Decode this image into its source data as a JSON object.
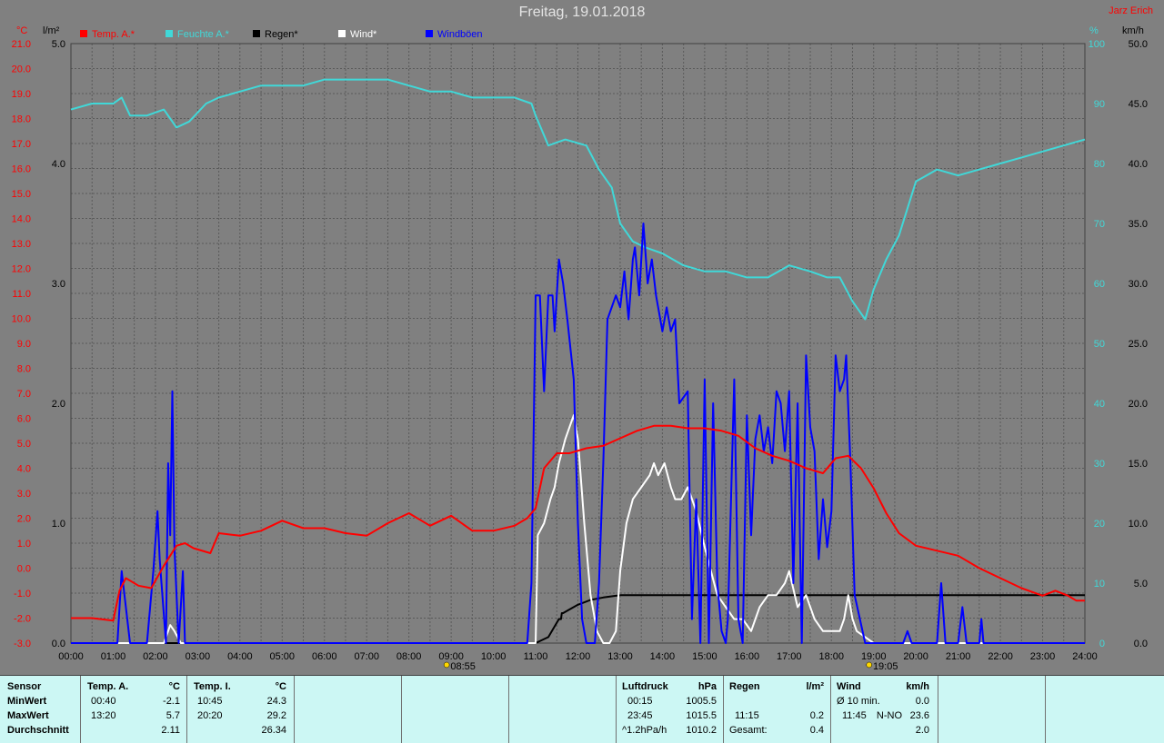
{
  "title": "Freitag, 19.01.2018",
  "author": "Jarz Erich",
  "colors": {
    "background": "#808080",
    "grid": "#5a5a5a",
    "temp": "#ff0000",
    "humidity": "#40d8d8",
    "rain": "#000000",
    "wind": "#ffffff",
    "gusts": "#0000ff",
    "stats_bg": "#ccf7f4"
  },
  "chart_data": {
    "type": "line",
    "title": "Freitag, 19.01.2018",
    "x_ticks": [
      "00:00",
      "01:00",
      "02:00",
      "03:00",
      "04:00",
      "05:00",
      "06:00",
      "07:00",
      "08:00",
      "09:00",
      "10:00",
      "11:00",
      "12:00",
      "13:00",
      "14:00",
      "15:00",
      "16:00",
      "17:00",
      "18:00",
      "19:00",
      "20:00",
      "21:00",
      "22:00",
      "23:00",
      "24:00"
    ],
    "x_range_hours": [
      0,
      24
    ],
    "sun_markers": [
      {
        "label": "08:55",
        "hour": 9.0
      },
      {
        "label": "19:05",
        "hour": 19.0
      }
    ],
    "axes": {
      "temp": {
        "unit": "°C",
        "range": [
          -3,
          21
        ],
        "ticks": [
          "21.0",
          "20.0",
          "19.0",
          "18.0",
          "17.0",
          "16.0",
          "15.0",
          "14.0",
          "13.0",
          "12.0",
          "11.0",
          "10.0",
          "9.0",
          "8.0",
          "7.0",
          "6.0",
          "5.0",
          "4.0",
          "3.0",
          "2.0",
          "1.0",
          "0.0",
          "-1.0",
          "-2.0",
          "-3.0"
        ]
      },
      "rain": {
        "unit": "l/m²",
        "range": [
          0,
          5
        ],
        "ticks": [
          "5.0",
          "4.0",
          "3.0",
          "2.0",
          "1.0",
          "0.0"
        ]
      },
      "humidity": {
        "unit": "%",
        "range": [
          0,
          100
        ],
        "ticks": [
          "100",
          "90",
          "80",
          "70",
          "60",
          "50",
          "40",
          "30",
          "20",
          "10",
          "0"
        ]
      },
      "wind": {
        "unit": "km/h",
        "range": [
          0,
          50
        ],
        "ticks": [
          "50.0",
          "45.0",
          "40.0",
          "35.0",
          "30.0",
          "25.0",
          "20.0",
          "15.0",
          "10.0",
          "5.0",
          "0.0"
        ]
      }
    },
    "grid": true,
    "legend_position": "top-left",
    "series": [
      {
        "key": "temp",
        "name": "Temp. A.*",
        "axis": "temp",
        "color": "#ff0000",
        "x": [
          0,
          0.5,
          1.0,
          1.15,
          1.3,
          1.6,
          1.9,
          2.2,
          2.5,
          2.7,
          2.9,
          3.3,
          3.5,
          4.0,
          4.5,
          5.0,
          5.5,
          6.0,
          6.5,
          7.0,
          7.5,
          8.0,
          8.5,
          9.0,
          9.5,
          10.0,
          10.5,
          10.8,
          11.0,
          11.2,
          11.5,
          11.8,
          12.2,
          12.6,
          13.0,
          13.4,
          13.8,
          14.2,
          14.6,
          15.0,
          15.4,
          15.8,
          16.2,
          16.6,
          17.0,
          17.4,
          17.8,
          18.1,
          18.4,
          18.7,
          19.0,
          19.3,
          19.6,
          20.0,
          20.5,
          21.0,
          21.5,
          22.0,
          22.5,
          23.0,
          23.3,
          23.6,
          23.8,
          24.0
        ],
        "y": [
          -2.0,
          -2.0,
          -2.1,
          -0.9,
          -0.4,
          -0.7,
          -0.8,
          0.1,
          0.9,
          1.0,
          0.8,
          0.6,
          1.4,
          1.3,
          1.5,
          1.9,
          1.6,
          1.6,
          1.4,
          1.3,
          1.8,
          2.2,
          1.7,
          2.1,
          1.5,
          1.5,
          1.7,
          2.0,
          2.4,
          4.0,
          4.6,
          4.6,
          4.8,
          4.9,
          5.2,
          5.5,
          5.7,
          5.7,
          5.6,
          5.6,
          5.5,
          5.3,
          4.8,
          4.5,
          4.3,
          4.0,
          3.8,
          4.4,
          4.5,
          4.0,
          3.2,
          2.2,
          1.4,
          0.9,
          0.7,
          0.5,
          0.0,
          -0.4,
          -0.8,
          -1.1,
          -0.9,
          -1.1,
          -1.3,
          -1.3
        ]
      },
      {
        "key": "humidity",
        "name": "Feuchte A.*",
        "axis": "humidity",
        "color": "#40d8d8",
        "x": [
          0,
          0.5,
          1.0,
          1.2,
          1.4,
          1.8,
          2.2,
          2.5,
          2.8,
          3.2,
          3.5,
          4.0,
          4.5,
          5.0,
          5.5,
          6.0,
          6.5,
          7.0,
          7.5,
          8.0,
          8.5,
          9.0,
          9.5,
          10.0,
          10.5,
          10.9,
          11.0,
          11.3,
          11.7,
          12.2,
          12.5,
          12.8,
          13.0,
          13.3,
          13.6,
          14.0,
          14.5,
          15.0,
          15.5,
          16.0,
          16.5,
          17.0,
          17.5,
          17.9,
          18.2,
          18.5,
          18.8,
          19.0,
          19.3,
          19.6,
          20.0,
          20.5,
          21.0,
          21.5,
          22.0,
          22.5,
          23.0,
          23.5,
          24.0
        ],
        "y": [
          89,
          90,
          90,
          91,
          88,
          88,
          89,
          86,
          87,
          90,
          91,
          92,
          93,
          93,
          93,
          94,
          94,
          94,
          94,
          93,
          92,
          92,
          91,
          91,
          91,
          90,
          88,
          83,
          84,
          83,
          79,
          76,
          70,
          67,
          66,
          65,
          63,
          62,
          62,
          61,
          61,
          63,
          62,
          61,
          61,
          57,
          54,
          59,
          64,
          68,
          77,
          79,
          78,
          79,
          80,
          81,
          82,
          83,
          84
        ]
      },
      {
        "key": "rain",
        "name": "Regen*",
        "axis": "rain",
        "color": "#000000",
        "x": [
          0,
          11.0,
          11.3,
          11.55,
          11.6,
          11.62,
          11.65,
          11.8,
          12.0,
          12.3,
          12.6,
          13.0,
          13.5,
          14.0,
          15.0,
          16.0,
          17.0,
          18.0,
          19.0,
          20.0,
          21.0,
          22.0,
          23.0,
          24.0
        ],
        "y": [
          0,
          0,
          0.05,
          0.2,
          0.2,
          0.25,
          0.25,
          0.28,
          0.32,
          0.36,
          0.38,
          0.4,
          0.4,
          0.4,
          0.4,
          0.4,
          0.4,
          0.4,
          0.4,
          0.4,
          0.4,
          0.4,
          0.4,
          0.4
        ]
      },
      {
        "key": "wind",
        "name": "Wind*",
        "axis": "wind",
        "color": "#ffffff",
        "x": [
          0,
          1.0,
          2.0,
          2.2,
          2.35,
          2.45,
          2.6,
          2.8,
          3.0,
          11.0,
          11.05,
          11.2,
          11.35,
          11.45,
          11.55,
          11.7,
          11.8,
          11.9,
          12.0,
          12.15,
          12.3,
          12.45,
          12.6,
          12.75,
          12.9,
          13.0,
          13.15,
          13.3,
          13.5,
          13.7,
          13.8,
          13.9,
          14.05,
          14.2,
          14.3,
          14.45,
          14.6,
          14.8,
          15.0,
          15.15,
          15.3,
          15.5,
          15.7,
          15.9,
          16.1,
          16.3,
          16.5,
          16.7,
          16.9,
          17.0,
          17.2,
          17.4,
          17.6,
          17.8,
          18.0,
          18.2,
          18.3,
          18.4,
          18.5,
          18.6,
          18.8,
          19.0,
          19.3,
          19.6,
          20.0,
          24.0
        ],
        "y": [
          0,
          0,
          0,
          0,
          1.5,
          1.0,
          0,
          0,
          0,
          0,
          9,
          10,
          12,
          13,
          15,
          17,
          18,
          19,
          17,
          10,
          4,
          1,
          0,
          0,
          1,
          6,
          10,
          12,
          13,
          14,
          15,
          14,
          15,
          13,
          12,
          12,
          13,
          11,
          8,
          6,
          4,
          3,
          2,
          2,
          1,
          3,
          4,
          4,
          5,
          6,
          3,
          4,
          2,
          1,
          1,
          1,
          2,
          4,
          2,
          1,
          0.5,
          0,
          0,
          0,
          0,
          0
        ]
      },
      {
        "key": "gusts",
        "name": "Windböen",
        "axis": "wind",
        "color": "#0000ff",
        "x": [
          0,
          1.1,
          1.2,
          1.3,
          1.4,
          1.5,
          1.8,
          1.95,
          2.05,
          2.1,
          2.25,
          2.3,
          2.35,
          2.4,
          2.45,
          2.55,
          2.65,
          2.7,
          2.75,
          3.0,
          10.8,
          10.9,
          11.0,
          11.1,
          11.2,
          11.3,
          11.4,
          11.45,
          11.55,
          11.65,
          11.75,
          11.9,
          12.0,
          12.1,
          12.2,
          12.4,
          12.5,
          12.6,
          12.7,
          12.9,
          13.0,
          13.1,
          13.2,
          13.3,
          13.35,
          13.45,
          13.55,
          13.65,
          13.75,
          13.85,
          13.95,
          14.0,
          14.1,
          14.2,
          14.3,
          14.4,
          14.6,
          14.7,
          14.8,
          14.9,
          15.0,
          15.1,
          15.2,
          15.3,
          15.4,
          15.5,
          15.55,
          15.7,
          15.8,
          15.9,
          16.0,
          16.1,
          16.2,
          16.3,
          16.4,
          16.5,
          16.6,
          16.7,
          16.8,
          16.9,
          17.0,
          17.1,
          17.2,
          17.3,
          17.4,
          17.5,
          17.6,
          17.7,
          17.8,
          17.9,
          18.0,
          18.1,
          18.2,
          18.3,
          18.35,
          18.45,
          18.55,
          18.8,
          19.0,
          19.7,
          19.8,
          19.9,
          20.5,
          20.6,
          20.7,
          21.0,
          21.1,
          21.2,
          21.5,
          21.55,
          21.6,
          22.0,
          24.0
        ],
        "y": [
          0,
          0,
          6,
          3,
          0,
          0,
          0,
          6,
          11,
          7,
          0,
          15,
          9,
          21,
          8,
          0,
          6,
          0,
          0,
          0,
          0,
          5,
          29,
          29,
          21,
          29,
          29,
          26,
          32,
          30,
          27,
          22,
          10,
          2,
          0,
          0,
          5,
          15,
          27,
          29,
          28,
          31,
          27,
          32,
          33,
          29,
          35,
          30,
          32,
          29,
          27,
          26,
          28,
          26,
          27,
          20,
          21,
          2,
          12,
          0,
          22,
          0,
          20,
          5,
          1,
          0,
          2,
          22,
          2,
          0,
          19,
          9,
          17,
          19,
          16,
          18,
          15,
          21,
          20,
          16,
          21,
          5,
          20,
          0,
          24,
          18,
          16,
          7,
          12,
          8,
          11,
          24,
          21,
          22,
          24,
          15,
          4,
          0,
          0,
          0,
          1,
          0,
          0,
          5,
          0,
          0,
          3,
          0,
          0,
          2,
          0,
          0,
          0
        ]
      }
    ]
  },
  "stats": {
    "sensor": "Sensor",
    "rows": [
      "MinWert",
      "MaxWert",
      "Durchschnitt"
    ],
    "temp_a": {
      "label": "Temp. A.",
      "unit": "°C",
      "min_time": "00:40",
      "min_val": "-2.1",
      "max_time": "13:20",
      "max_val": "5.7",
      "avg": "2.11"
    },
    "temp_i": {
      "label": "Temp. I.",
      "unit": "°C",
      "min_time": "10:45",
      "min_val": "24.3",
      "max_time": "20:20",
      "max_val": "29.2",
      "avg": "26.34"
    },
    "pressure": {
      "label": "Luftdruck",
      "unit": "hPa",
      "min_time": "00:15",
      "min_val": "1005.5",
      "max_time": "23:45",
      "max_val": "1015.5",
      "trend_label": "^1.2hPa/h",
      "trend_val": "1010.2"
    },
    "rain": {
      "label": "Regen",
      "unit": "l/m²",
      "max_time": "11:15",
      "max_val": "0.2",
      "total_label": "Gesamt:",
      "total_val": "0.4"
    },
    "wind": {
      "label": "Wind",
      "unit": "km/h",
      "avg10_label": "Ø 10 min.",
      "avg10_val": "0.0",
      "max_time": "11:45",
      "max_dir": "N-NO",
      "max_val": "23.6",
      "avg": "2.0"
    }
  }
}
